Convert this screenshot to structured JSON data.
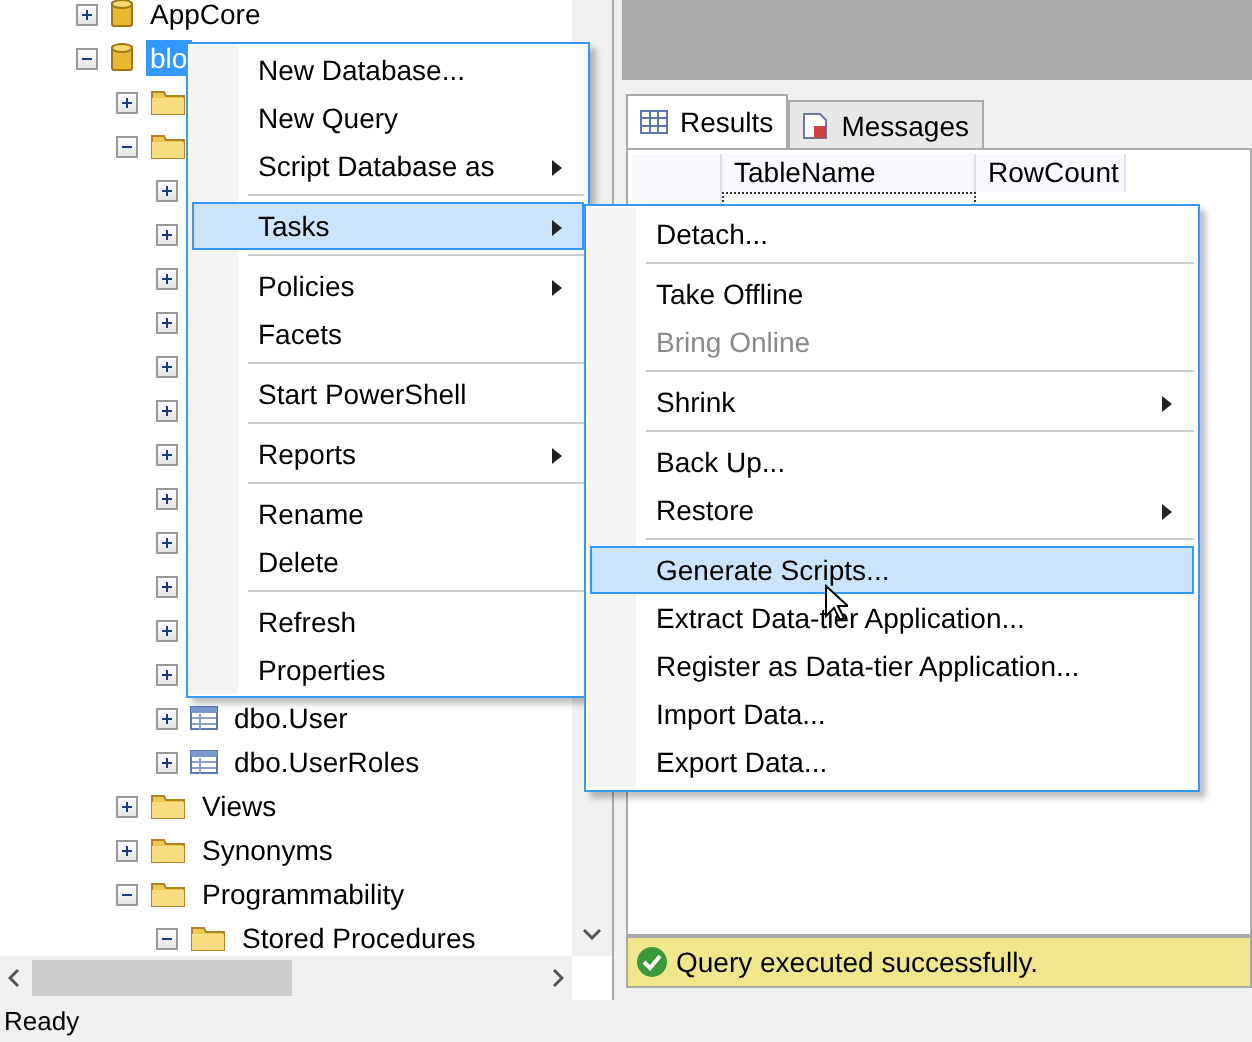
{
  "object_explorer": {
    "tree": [
      {
        "kind": "database",
        "label": "AppCore",
        "expanded": false,
        "selected": false
      },
      {
        "kind": "database",
        "label": "blo",
        "expanded": true,
        "selected": true,
        "children": [
          {
            "kind": "folder",
            "expanded": false
          },
          {
            "kind": "folder",
            "expanded": true,
            "children": [
              {
                "kind": "table",
                "expanded": false
              },
              {
                "kind": "table",
                "expanded": false
              },
              {
                "kind": "table",
                "expanded": false
              },
              {
                "kind": "table",
                "expanded": false
              },
              {
                "kind": "table",
                "expanded": false
              },
              {
                "kind": "table",
                "expanded": false
              },
              {
                "kind": "table",
                "expanded": false
              },
              {
                "kind": "table",
                "expanded": false
              },
              {
                "kind": "table",
                "expanded": false
              },
              {
                "kind": "table",
                "expanded": false
              },
              {
                "kind": "table",
                "expanded": false
              },
              {
                "kind": "table",
                "expanded": false
              },
              {
                "kind": "table",
                "label": "dbo.User",
                "expanded": false,
                "selected": false
              },
              {
                "kind": "table",
                "label": "dbo.UserRoles",
                "expanded": false,
                "selected": false
              }
            ]
          },
          {
            "kind": "folder",
            "label": "Views",
            "expanded": false,
            "selected": false
          },
          {
            "kind": "folder",
            "label": "Synonyms",
            "expanded": false,
            "selected": false
          },
          {
            "kind": "folder",
            "label": "Programmability",
            "expanded": true,
            "selected": false,
            "children": [
              {
                "kind": "folder",
                "label": "Stored Procedures",
                "expanded": true,
                "selected": false
              }
            ]
          }
        ]
      }
    ]
  },
  "results": {
    "tabs": [
      {
        "label": "Results",
        "selected": true
      },
      {
        "label": "Messages",
        "selected": false
      }
    ],
    "columns": [
      "TableName",
      "RowCount"
    ],
    "message": "Query executed successfully."
  },
  "context_menu": {
    "items": [
      {
        "kind": "item",
        "label": "New Database...",
        "submenu": false,
        "selected": false
      },
      {
        "kind": "item",
        "label": "New Query",
        "submenu": false,
        "selected": false
      },
      {
        "kind": "item",
        "label": "Script Database as",
        "submenu": true,
        "selected": false
      },
      {
        "kind": "separator"
      },
      {
        "kind": "item",
        "label": "Tasks",
        "submenu": true,
        "selected": true
      },
      {
        "kind": "separator"
      },
      {
        "kind": "item",
        "label": "Policies",
        "submenu": true,
        "selected": false
      },
      {
        "kind": "item",
        "label": "Facets",
        "submenu": false,
        "selected": false
      },
      {
        "kind": "separator"
      },
      {
        "kind": "item",
        "label": "Start PowerShell",
        "submenu": false,
        "selected": false
      },
      {
        "kind": "separator"
      },
      {
        "kind": "item",
        "label": "Reports",
        "submenu": true,
        "selected": false
      },
      {
        "kind": "separator"
      },
      {
        "kind": "item",
        "label": "Rename",
        "submenu": false,
        "selected": false
      },
      {
        "kind": "item",
        "label": "Delete",
        "submenu": false,
        "selected": false
      },
      {
        "kind": "separator"
      },
      {
        "kind": "item",
        "label": "Refresh",
        "submenu": false,
        "selected": false
      },
      {
        "kind": "item",
        "label": "Properties",
        "submenu": false,
        "selected": false
      }
    ]
  },
  "tasks_submenu": {
    "items": [
      {
        "kind": "item",
        "label": "Detach...",
        "submenu": false,
        "selected": false,
        "disabled": false
      },
      {
        "kind": "separator"
      },
      {
        "kind": "item",
        "label": "Take Offline",
        "submenu": false,
        "selected": false,
        "disabled": false
      },
      {
        "kind": "item",
        "label": "Bring Online",
        "submenu": false,
        "selected": false,
        "disabled": true
      },
      {
        "kind": "separator"
      },
      {
        "kind": "item",
        "label": "Shrink",
        "submenu": true,
        "selected": false,
        "disabled": false
      },
      {
        "kind": "separator"
      },
      {
        "kind": "item",
        "label": "Back Up...",
        "submenu": false,
        "selected": false,
        "disabled": false
      },
      {
        "kind": "item",
        "label": "Restore",
        "submenu": true,
        "selected": false,
        "disabled": false
      },
      {
        "kind": "separator"
      },
      {
        "kind": "item",
        "label": "Generate Scripts...",
        "submenu": false,
        "selected": true,
        "disabled": false
      },
      {
        "kind": "item",
        "label": "Extract Data-tier Application...",
        "submenu": false,
        "selected": false,
        "disabled": false
      },
      {
        "kind": "item",
        "label": "Register as Data-tier Application...",
        "submenu": false,
        "selected": false,
        "disabled": false
      },
      {
        "kind": "item",
        "label": "Import Data...",
        "submenu": false,
        "selected": false,
        "disabled": false
      },
      {
        "kind": "item",
        "label": "Export Data...",
        "submenu": false,
        "selected": false,
        "disabled": false
      }
    ]
  },
  "status_bar": {
    "text": "Ready"
  }
}
